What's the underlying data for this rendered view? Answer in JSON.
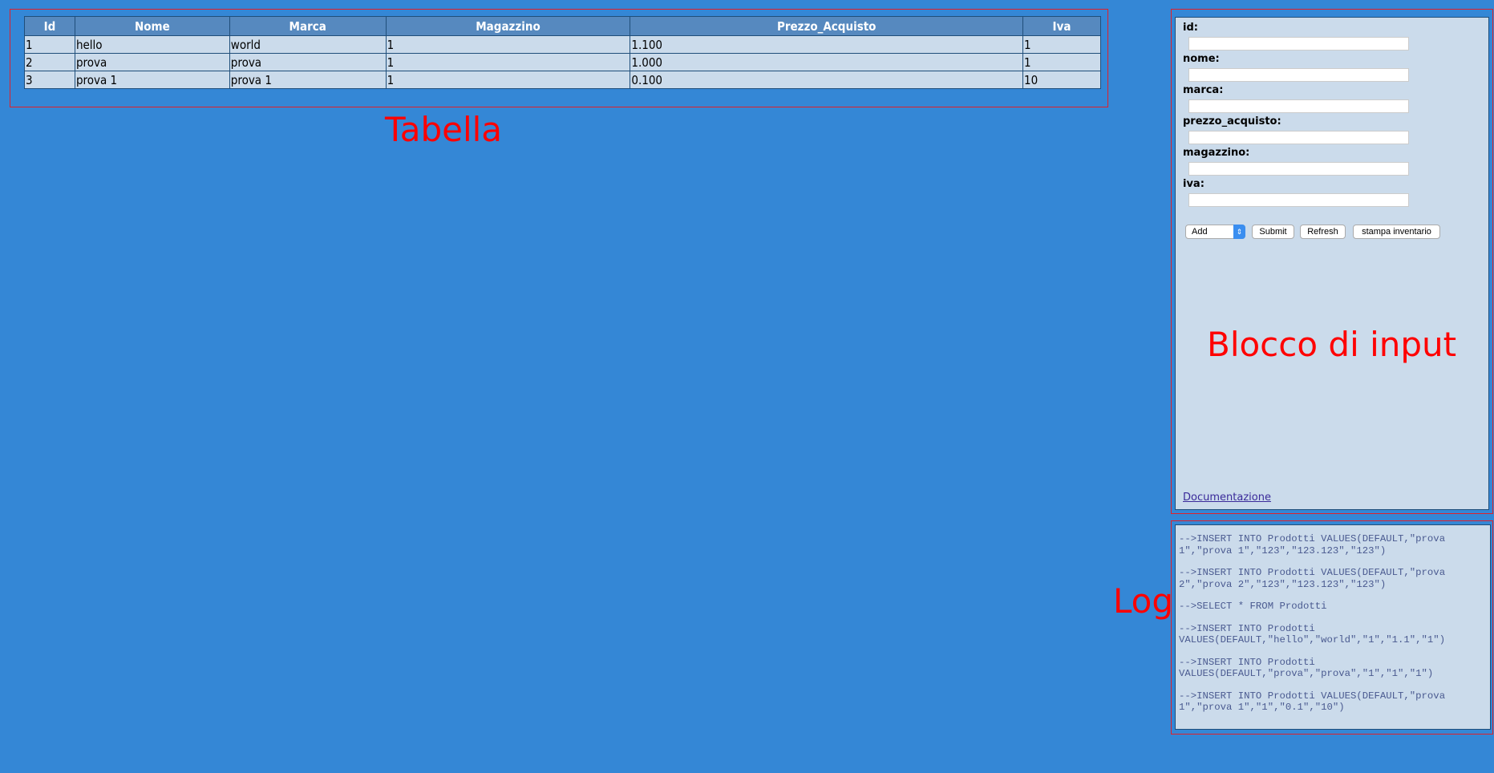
{
  "table": {
    "headers": [
      "Id",
      "Nome",
      "Marca",
      "Magazzino",
      "Prezzo_Acquisto",
      "Iva"
    ],
    "rows": [
      [
        "1",
        "hello",
        "world",
        "1",
        "1.100",
        "1"
      ],
      [
        "2",
        "prova",
        "prova",
        "1",
        "1.000",
        "1"
      ],
      [
        "3",
        "prova 1",
        "prova 1",
        "1",
        "0.100",
        "10"
      ]
    ]
  },
  "annotations": {
    "table": "Tabella",
    "input": "Blocco di input",
    "log": "Log"
  },
  "form": {
    "labels": [
      "id:",
      "nome:",
      "marca:",
      "prezzo_acquisto:",
      "magazzino:",
      "iva:"
    ],
    "action_select": "Add",
    "submit": "Submit",
    "refresh": "Refresh",
    "print": "stampa inventario",
    "doc_link": "Documentazione"
  },
  "log": [
    "-->INSERT INTO Prodotti VALUES(DEFAULT,\"prova 1\",\"prova 1\",\"123\",\"123.123\",\"123\")",
    "-->INSERT INTO Prodotti VALUES(DEFAULT,\"prova 2\",\"prova 2\",\"123\",\"123.123\",\"123\")",
    "-->SELECT * FROM Prodotti",
    "-->INSERT INTO Prodotti VALUES(DEFAULT,\"hello\",\"world\",\"1\",\"1.1\",\"1\")",
    "-->INSERT INTO Prodotti VALUES(DEFAULT,\"prova\",\"prova\",\"1\",\"1\",\"1\")",
    "-->INSERT INTO Prodotti VALUES(DEFAULT,\"prova 1\",\"prova 1\",\"1\",\"0.1\",\"10\")"
  ]
}
